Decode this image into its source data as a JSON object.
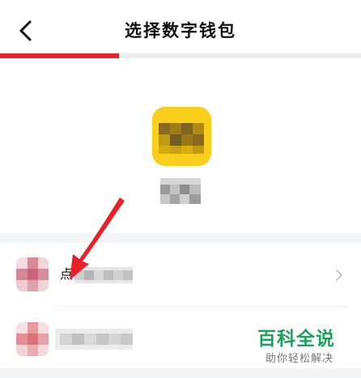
{
  "header": {
    "title": "选择数字钱包",
    "progress_fraction": 0.33
  },
  "wallet_list": {
    "items": [
      {
        "label_visible_char": "点"
      },
      {
        "label_visible_char": ""
      }
    ]
  },
  "watermark": {
    "brand": "百科全说",
    "slogan": "助你轻松解决"
  },
  "colors": {
    "accent_red": "#e4262e",
    "wallet_yellow": "#f7c71a",
    "watermark_green": "#1aa45b"
  },
  "icons": {
    "back": "chevron-left-icon",
    "row_arrow": "chevron-right-icon"
  }
}
